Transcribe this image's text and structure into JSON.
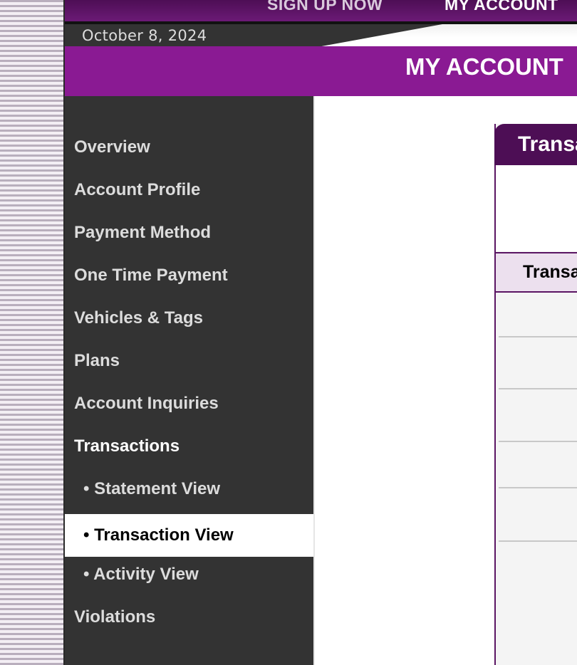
{
  "header": {
    "nav_links": [
      "SIGN UP NOW",
      "MY ACCOUNT"
    ],
    "date": "October 8, 2024",
    "page_title": "MY ACCOUNT"
  },
  "sidebar": {
    "items": [
      {
        "label": "Overview"
      },
      {
        "label": "Account Profile"
      },
      {
        "label": "Payment Method"
      },
      {
        "label": "One Time Payment"
      },
      {
        "label": "Vehicles & Tags"
      },
      {
        "label": "Plans"
      },
      {
        "label": "Account Inquiries"
      },
      {
        "label": "Transactions"
      },
      {
        "label": "• Statement View"
      },
      {
        "label": "• Transaction View"
      },
      {
        "label": "• Activity View"
      },
      {
        "label": "Violations"
      }
    ],
    "active_item": "• Transaction View"
  },
  "panel": {
    "title": "Transa",
    "column_header": "Transa"
  },
  "colors": {
    "brand_purple": "#8a1a93",
    "dark_purple": "#4d0e55",
    "sidebar_bg": "#333333"
  }
}
